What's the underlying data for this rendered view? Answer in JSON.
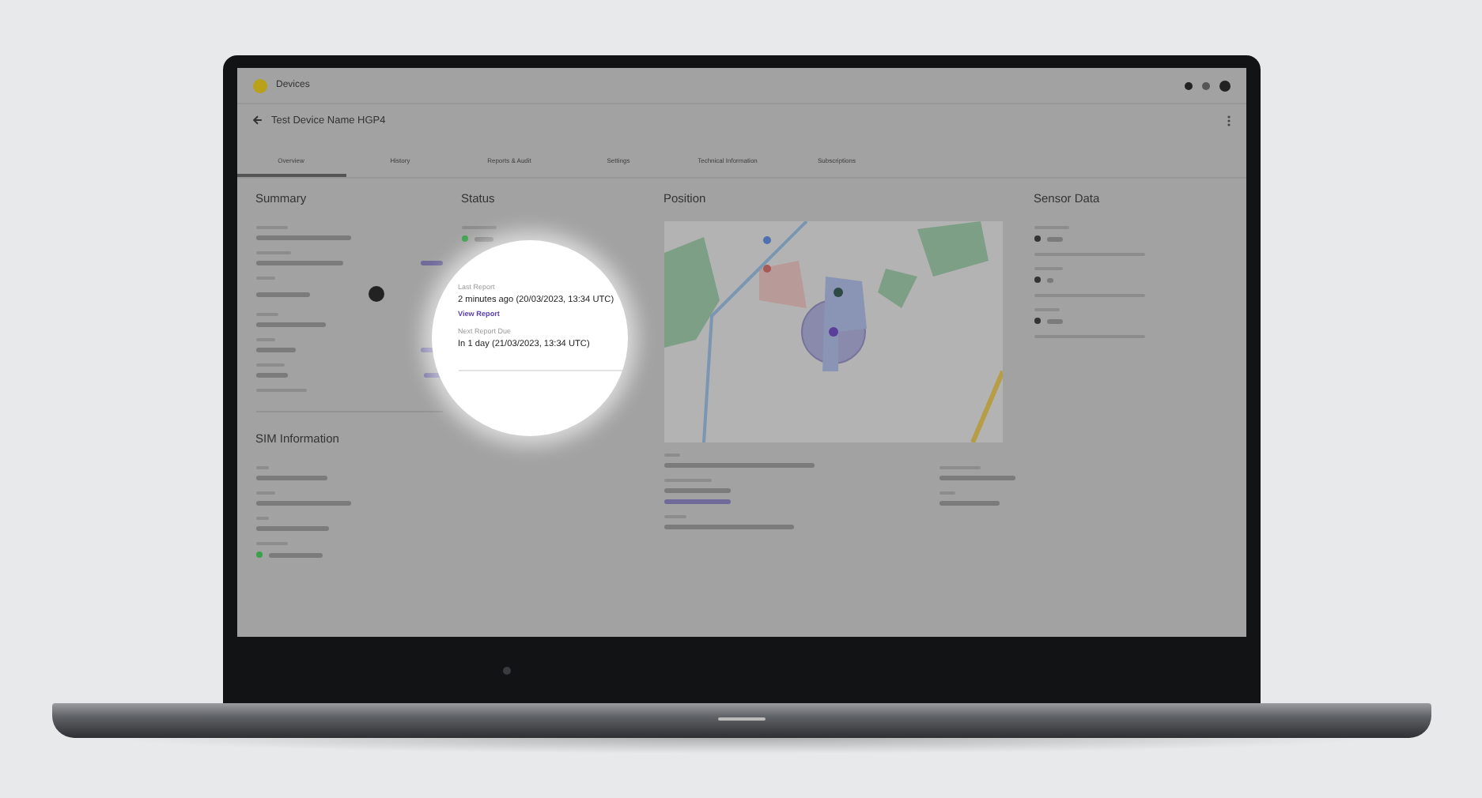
{
  "app": {
    "title": "Devices"
  },
  "device": {
    "name": "Test Device Name HGP4"
  },
  "tabs": [
    {
      "label": "Overview",
      "selected": true
    },
    {
      "label": "History",
      "selected": false
    },
    {
      "label": "Reports & Audit",
      "selected": false
    },
    {
      "label": "Settings",
      "selected": false
    },
    {
      "label": "Technical Information",
      "selected": false
    },
    {
      "label": "Subscriptions",
      "selected": false
    }
  ],
  "summary": {
    "title": "Summary"
  },
  "sim": {
    "title": "SIM Information"
  },
  "status": {
    "title": "Status"
  },
  "spotlight": {
    "last_label": "Last Report",
    "last_value": "2 minutes ago (20/03/2023, 13:34 UTC)",
    "link": "View Report",
    "next_label": "Next Report Due",
    "next_value": "In 1 day (21/03/2023, 13:34 UTC)"
  },
  "position": {
    "title": "Position"
  },
  "sensors": {
    "title": "Sensor Data"
  }
}
